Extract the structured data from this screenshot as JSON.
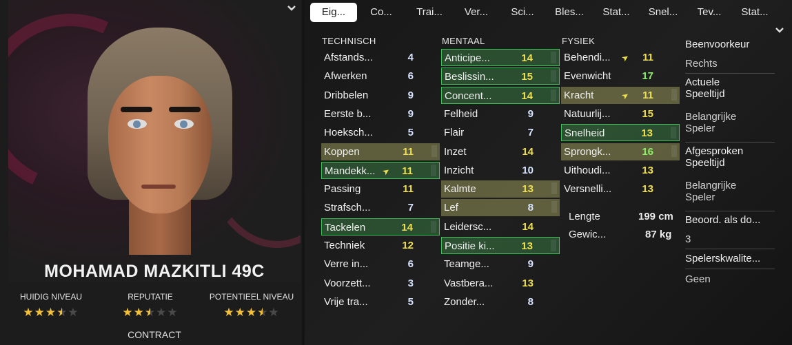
{
  "player": {
    "name": "MOHAMAD MAZKITLI 49C",
    "ratings": [
      {
        "label": "HUIDIG NIVEAU",
        "stars": 3.5
      },
      {
        "label": "REPUTATIE",
        "stars": 2.5
      },
      {
        "label": "POTENTIEEL NIVEAU",
        "stars": 3.5
      }
    ],
    "contract_label": "CONTRACT"
  },
  "tabs": [
    "Eig...",
    "Co...",
    "Trai...",
    "Ver...",
    "Sci...",
    "Bles...",
    "Stat...",
    "Snel...",
    "Tev...",
    "Stat..."
  ],
  "active_tab": 0,
  "icons": {
    "collapse": "chevron-down-icon",
    "more": "chevron-down-icon",
    "trend": "trend-up-arrow-icon",
    "star": "star-icon"
  },
  "colors": {
    "value_white": "#d8e4ff",
    "value_yellow": "#f0e050",
    "value_green": "#8ef06a",
    "highlight_green": "#3fbf5a",
    "highlight_olive": "#96965a",
    "star": "#f3c038"
  },
  "columns": {
    "technical": {
      "title": "TECHNISCH",
      "attrs": [
        {
          "name": "Afstands...",
          "value": "4",
          "color": "white",
          "hl": ""
        },
        {
          "name": "Afwerken",
          "value": "6",
          "color": "white",
          "hl": ""
        },
        {
          "name": "Dribbelen",
          "value": "9",
          "color": "white",
          "hl": ""
        },
        {
          "name": "Eerste b...",
          "value": "9",
          "color": "white",
          "hl": ""
        },
        {
          "name": "Hoeksch...",
          "value": "5",
          "color": "white",
          "hl": ""
        },
        {
          "name": "Koppen",
          "value": "11",
          "color": "yellow",
          "hl": "olive"
        },
        {
          "name": "Mandekk...",
          "value": "11",
          "color": "yellow",
          "hl": "green",
          "trend": true
        },
        {
          "name": "Passing",
          "value": "11",
          "color": "yellow",
          "hl": ""
        },
        {
          "name": "Strafsch...",
          "value": "7",
          "color": "white",
          "hl": ""
        },
        {
          "name": "Tackelen",
          "value": "14",
          "color": "yellow",
          "hl": "green"
        },
        {
          "name": "Techniek",
          "value": "12",
          "color": "yellow",
          "hl": ""
        },
        {
          "name": "Verre in...",
          "value": "6",
          "color": "white",
          "hl": ""
        },
        {
          "name": "Voorzett...",
          "value": "3",
          "color": "white",
          "hl": ""
        },
        {
          "name": "Vrije tra...",
          "value": "5",
          "color": "white",
          "hl": ""
        }
      ]
    },
    "mental": {
      "title": "MENTAAL",
      "attrs": [
        {
          "name": "Anticipe...",
          "value": "14",
          "color": "yellow",
          "hl": "green"
        },
        {
          "name": "Beslissin...",
          "value": "15",
          "color": "yellow",
          "hl": "green"
        },
        {
          "name": "Concent...",
          "value": "14",
          "color": "yellow",
          "hl": "green"
        },
        {
          "name": "Felheid",
          "value": "9",
          "color": "white",
          "hl": ""
        },
        {
          "name": "Flair",
          "value": "7",
          "color": "white",
          "hl": ""
        },
        {
          "name": "Inzet",
          "value": "14",
          "color": "yellow",
          "hl": ""
        },
        {
          "name": "Inzicht",
          "value": "10",
          "color": "white",
          "hl": ""
        },
        {
          "name": "Kalmte",
          "value": "13",
          "color": "yellow",
          "hl": "olive"
        },
        {
          "name": "Lef",
          "value": "8",
          "color": "white",
          "hl": "olive"
        },
        {
          "name": "Leidersc...",
          "value": "14",
          "color": "yellow",
          "hl": ""
        },
        {
          "name": "Positie ki...",
          "value": "13",
          "color": "yellow",
          "hl": "green"
        },
        {
          "name": "Teamge...",
          "value": "9",
          "color": "white",
          "hl": ""
        },
        {
          "name": "Vastbera...",
          "value": "13",
          "color": "yellow",
          "hl": ""
        },
        {
          "name": "Zonder...",
          "value": "8",
          "color": "white",
          "hl": ""
        }
      ]
    },
    "physical": {
      "title": "FYSIEK",
      "attrs": [
        {
          "name": "Behendi...",
          "value": "11",
          "color": "yellow",
          "hl": "",
          "trend": true
        },
        {
          "name": "Evenwicht",
          "value": "17",
          "color": "green",
          "hl": ""
        },
        {
          "name": "Kracht",
          "value": "11",
          "color": "yellow",
          "hl": "olive",
          "trend": true
        },
        {
          "name": "Natuurlij...",
          "value": "15",
          "color": "yellow",
          "hl": ""
        },
        {
          "name": "Snelheid",
          "value": "13",
          "color": "yellow",
          "hl": "green"
        },
        {
          "name": "Sprongk...",
          "value": "16",
          "color": "green",
          "hl": "olive"
        },
        {
          "name": "Uithoudi...",
          "value": "13",
          "color": "yellow",
          "hl": ""
        },
        {
          "name": "Versnelli...",
          "value": "13",
          "color": "yellow",
          "hl": ""
        }
      ],
      "info": [
        {
          "label": "Lengte",
          "value": "199 cm"
        },
        {
          "label": "Gewic...",
          "value": "87 kg"
        }
      ]
    }
  },
  "side": [
    {
      "label": "Beenvoorkeur",
      "value": "Rechts"
    },
    {
      "label": "Actuele Speeltijd",
      "value": "Belangrijke Speler"
    },
    {
      "label": "Afgesproken Speeltijd",
      "value": "Belangrijke Speler"
    },
    {
      "label": "Beoord. als do...",
      "value": "3"
    },
    {
      "label": "Spelerskwalite...",
      "value": "Geen"
    }
  ]
}
